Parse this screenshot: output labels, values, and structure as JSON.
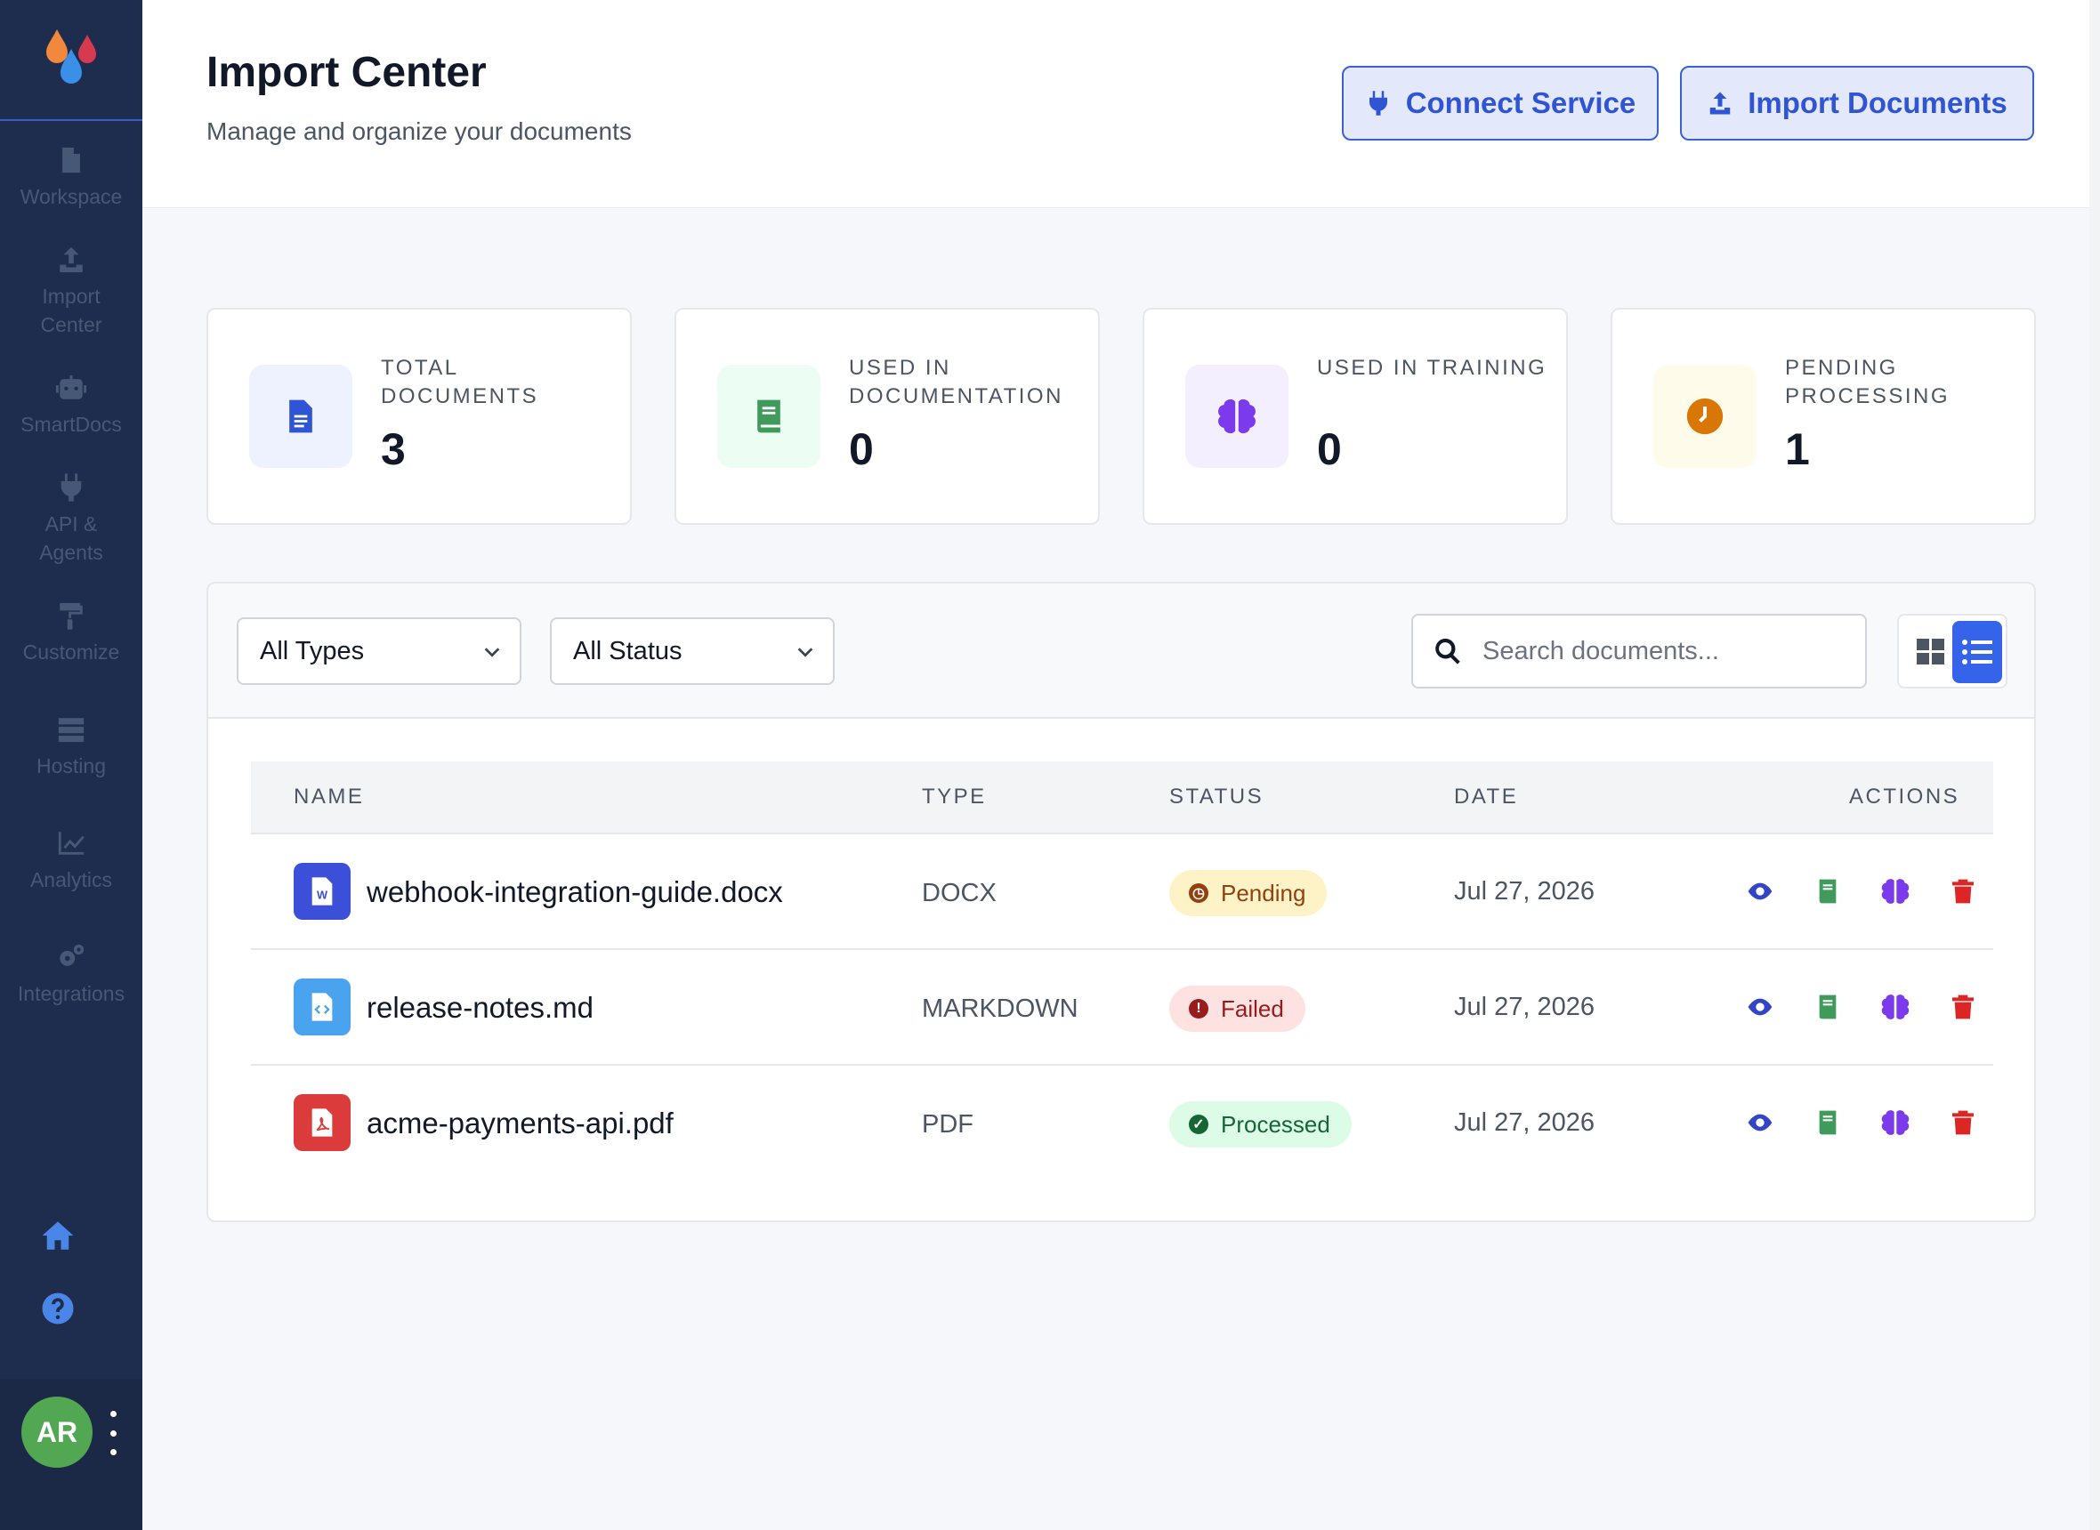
{
  "sidebar": {
    "items": [
      {
        "label": "Workspace",
        "icon": "file-icon"
      },
      {
        "label": "Import Center",
        "icon": "upload-icon"
      },
      {
        "label": "SmartDocs",
        "icon": "robot-icon"
      },
      {
        "label": "API & Agents",
        "icon": "plug-icon"
      },
      {
        "label": "Customize",
        "icon": "paint-roller-icon"
      },
      {
        "label": "Hosting",
        "icon": "server-icon"
      },
      {
        "label": "Analytics",
        "icon": "chart-icon"
      },
      {
        "label": "Integrations",
        "icon": "gears-icon"
      }
    ],
    "user_initials": "AR"
  },
  "header": {
    "title": "Import Center",
    "subtitle": "Manage and organize your documents",
    "connect_label": "Connect Service",
    "import_label": "Import Documents"
  },
  "stats": [
    {
      "label": "TOTAL DOCUMENTS",
      "value": "3",
      "color": "#2f55d4",
      "bg": "#eef2ff"
    },
    {
      "label": "USED IN DOCUMENTATION",
      "value": "0",
      "color": "#3f9a5c",
      "bg": "#ecfdf3"
    },
    {
      "label": "USED IN TRAINING",
      "value": "0",
      "color": "#7c3aed",
      "bg": "#f3efff"
    },
    {
      "label": "PENDING PROCESSING",
      "value": "1",
      "color": "#d97706",
      "bg": "#fffbeb"
    }
  ],
  "filters": {
    "type_selected": "All Types",
    "status_selected": "All Status",
    "search_placeholder": "Search documents..."
  },
  "table": {
    "headers": {
      "name": "NAME",
      "type": "TYPE",
      "status": "STATUS",
      "date": "DATE",
      "actions": "ACTIONS"
    },
    "rows": [
      {
        "name": "webhook-integration-guide.docx",
        "type": "DOCX",
        "status": "Pending",
        "date": "Jul 27, 2026",
        "file_icon": "word-file-icon"
      },
      {
        "name": "release-notes.md",
        "type": "MARKDOWN",
        "status": "Failed",
        "date": "Jul 27, 2026",
        "file_icon": "code-file-icon"
      },
      {
        "name": "acme-payments-api.pdf",
        "type": "PDF",
        "status": "Processed",
        "date": "Jul 27, 2026",
        "file_icon": "pdf-file-icon"
      }
    ]
  },
  "colors": {
    "sidebar_bg": "#1e2c4d",
    "accent": "#3563e9",
    "pending_bg": "#fef3c7",
    "failed_bg": "#fee2e2",
    "processed_bg": "#dcfce7"
  }
}
